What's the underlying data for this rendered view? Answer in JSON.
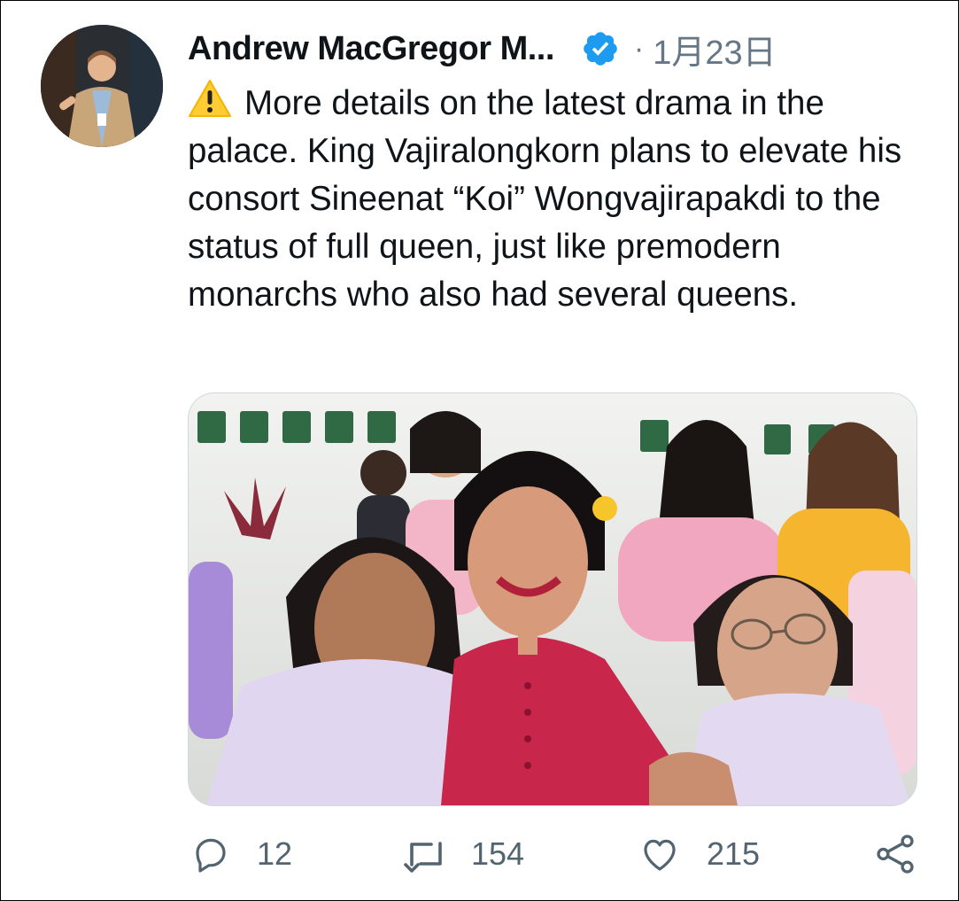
{
  "tweet": {
    "author_name": "Andrew MacGregor M...",
    "date_separator": "·",
    "date": "1月23日",
    "warning_emoji": "⚠️",
    "text": "More details on the latest drama in the palace. King Vajiralongkorn plans to elevate his consort Sineenat “Koi” Wongvajirapakdi to the status of full queen, just like premodern monarchs who also had several queens."
  },
  "actions": {
    "reply_count": "12",
    "retweet_count": "154",
    "like_count": "215"
  },
  "icons": {
    "verified": "verified-badge-icon",
    "reply": "reply-bubble-icon",
    "retweet": "retweet-arrows-icon",
    "like": "heart-icon",
    "share": "share-icon"
  },
  "colors": {
    "verified_blue": "#1d9bf0",
    "text": "#0f1419",
    "secondary": "#536471",
    "warning_yellow": "#ffcc33",
    "dress_red": "#c8264a"
  }
}
